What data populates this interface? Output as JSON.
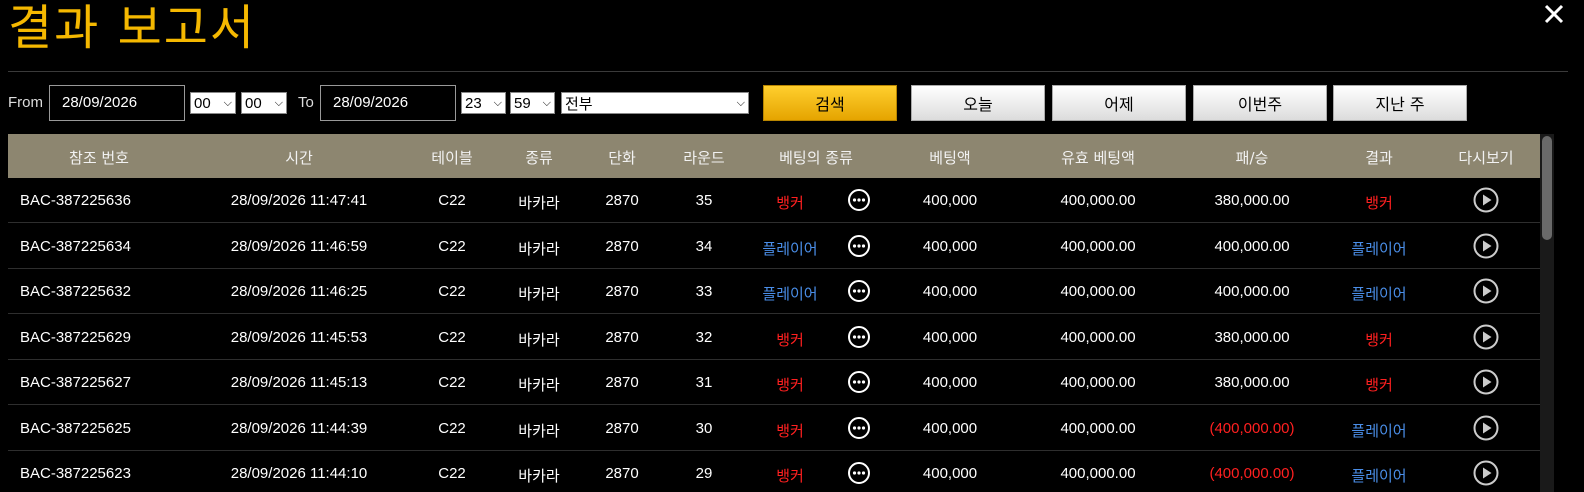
{
  "header": {
    "title": "결과 보고서"
  },
  "filters": {
    "from_label": "From",
    "from_date": "28/09/2026",
    "from_hour": "00",
    "from_minute": "00",
    "to_label": "To",
    "to_date": "28/09/2026",
    "to_hour": "23",
    "to_minute": "59",
    "game_type": "전부",
    "search_label": "검색",
    "today_label": "오늘",
    "yesterday_label": "어제",
    "this_week_label": "이번주",
    "last_week_label": "지난 주"
  },
  "table": {
    "columns": [
      "참조 번호",
      "시간",
      "테이블",
      "종류",
      "단화",
      "라운드",
      "베팅의 종류",
      "베팅액",
      "유효 베팅액",
      "패/승",
      "결과",
      "다시보기"
    ],
    "rows": [
      {
        "ref": "BAC-387225636",
        "time": "28/09/2026 11:47:41",
        "table": "C22",
        "type": "바카라",
        "shoe": "2870",
        "round": "35",
        "bet_type": "뱅커",
        "bet_color": "red",
        "bet": "400,000",
        "valid_bet": "400,000.00",
        "win_loss": "380,000.00",
        "wl_color": "white",
        "result": "뱅커",
        "result_color": "red"
      },
      {
        "ref": "BAC-387225634",
        "time": "28/09/2026 11:46:59",
        "table": "C22",
        "type": "바카라",
        "shoe": "2870",
        "round": "34",
        "bet_type": "플레이어",
        "bet_color": "blue",
        "bet": "400,000",
        "valid_bet": "400,000.00",
        "win_loss": "400,000.00",
        "wl_color": "white",
        "result": "플레이어",
        "result_color": "blue"
      },
      {
        "ref": "BAC-387225632",
        "time": "28/09/2026 11:46:25",
        "table": "C22",
        "type": "바카라",
        "shoe": "2870",
        "round": "33",
        "bet_type": "플레이어",
        "bet_color": "blue",
        "bet": "400,000",
        "valid_bet": "400,000.00",
        "win_loss": "400,000.00",
        "wl_color": "white",
        "result": "플레이어",
        "result_color": "blue"
      },
      {
        "ref": "BAC-387225629",
        "time": "28/09/2026 11:45:53",
        "table": "C22",
        "type": "바카라",
        "shoe": "2870",
        "round": "32",
        "bet_type": "뱅커",
        "bet_color": "red",
        "bet": "400,000",
        "valid_bet": "400,000.00",
        "win_loss": "380,000.00",
        "wl_color": "white",
        "result": "뱅커",
        "result_color": "red"
      },
      {
        "ref": "BAC-387225627",
        "time": "28/09/2026 11:45:13",
        "table": "C22",
        "type": "바카라",
        "shoe": "2870",
        "round": "31",
        "bet_type": "뱅커",
        "bet_color": "red",
        "bet": "400,000",
        "valid_bet": "400,000.00",
        "win_loss": "380,000.00",
        "wl_color": "white",
        "result": "뱅커",
        "result_color": "red"
      },
      {
        "ref": "BAC-387225625",
        "time": "28/09/2026 11:44:39",
        "table": "C22",
        "type": "바카라",
        "shoe": "2870",
        "round": "30",
        "bet_type": "뱅커",
        "bet_color": "red",
        "bet": "400,000",
        "valid_bet": "400,000.00",
        "win_loss": "(400,000.00)",
        "wl_color": "red",
        "result": "플레이어",
        "result_color": "blue"
      },
      {
        "ref": "BAC-387225623",
        "time": "28/09/2026 11:44:10",
        "table": "C22",
        "type": "바카라",
        "shoe": "2870",
        "round": "29",
        "bet_type": "뱅커",
        "bet_color": "red",
        "bet": "400,000",
        "valid_bet": "400,000.00",
        "win_loss": "(400,000.00)",
        "wl_color": "red",
        "result": "플레이어",
        "result_color": "blue"
      }
    ]
  },
  "icons": {
    "close": "close-icon",
    "bet_detail": "more-dots-icon",
    "replay": "play-icon"
  },
  "colors": {
    "accent": "#f5b800",
    "header_bg": "#8d8670",
    "banker": "#ff2020",
    "player": "#4a8ee8"
  }
}
